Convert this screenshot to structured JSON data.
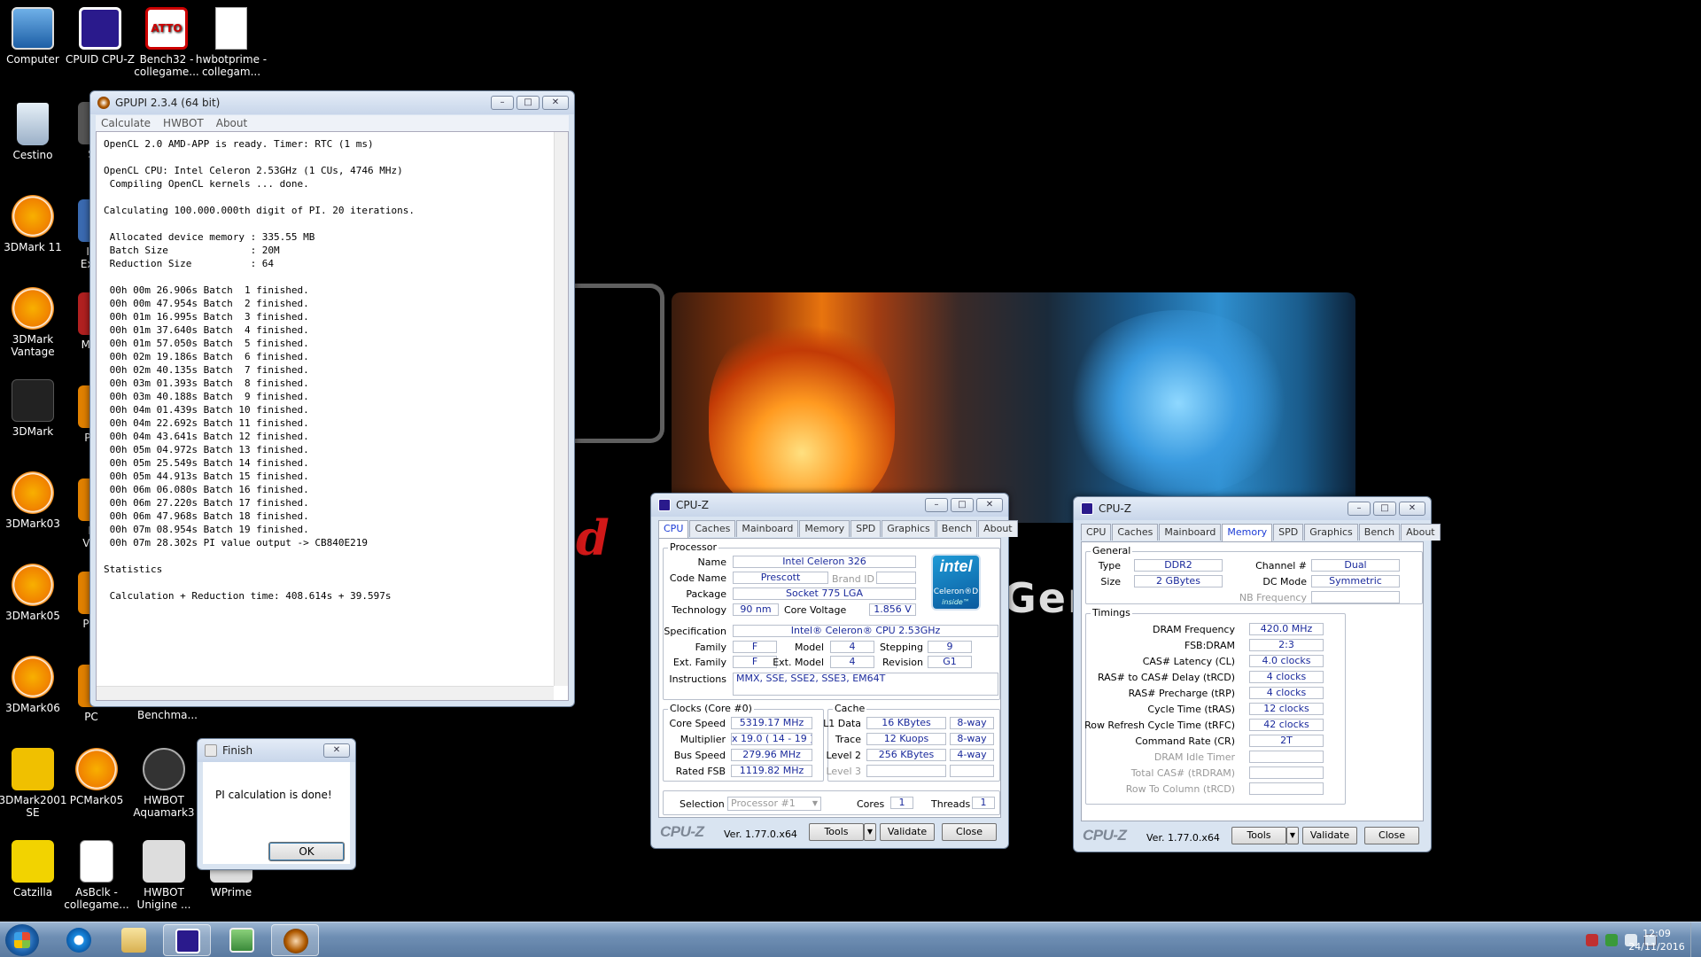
{
  "desktop": {
    "wallpaper_text_left": "d",
    "wallpaper_text_right": "Gene",
    "icons": [
      {
        "label": "Computer",
        "icon": "computer-icon"
      },
      {
        "label": "CPUID CPU-Z",
        "icon": "cpuz-icon"
      },
      {
        "label": "Bench32 - collegame...",
        "icon": "atto-icon",
        "badge": "ATTO"
      },
      {
        "label": "hwbotprime - collegam...",
        "icon": "document-icon"
      },
      {
        "label": "Cestino",
        "icon": "recycle-bin-icon"
      },
      {
        "label": "3DMark 11",
        "icon": "3dmark-icon"
      },
      {
        "label": "3DMark Vantage",
        "icon": "3dmark-icon"
      },
      {
        "label": "3DMark",
        "icon": "3dmark-arrow-icon"
      },
      {
        "label": "3DMark03",
        "icon": "3dmark-icon"
      },
      {
        "label": "3DMark05",
        "icon": "3dmark-icon"
      },
      {
        "label": "3DMark06",
        "icon": "3dmark-icon"
      },
      {
        "label": "3DMark2001 SE",
        "icon": "3dmark2001-icon"
      },
      {
        "label": "PCMark05",
        "icon": "pcmark-icon"
      },
      {
        "label": "HWBOT Aquamark3",
        "icon": "aquamark-icon"
      },
      {
        "label": "Catzilla",
        "icon": "catzilla-icon"
      },
      {
        "label": "AsBclk - collegame...",
        "icon": "asbclk-icon"
      },
      {
        "label": "HWBOT Unigine ...",
        "icon": "unigine-icon"
      },
      {
        "label": "WPrime",
        "icon": "wprime-icon"
      },
      {
        "label": "Benchma...",
        "icon": "benchmark-icon"
      }
    ],
    "partial_labels": [
      "S",
      "In Extr",
      "Mer",
      "PC",
      "P Var",
      "P V",
      "PC"
    ]
  },
  "gpupi": {
    "title": "GPUPI 2.3.4 (64 bit)",
    "menu": [
      "Calculate",
      "HWBOT",
      "About"
    ],
    "output_lines": [
      "OpenCL 2.0 AMD-APP is ready. Timer: RTC (1 ms)",
      "",
      "OpenCL CPU: Intel Celeron 2.53GHz (1 CUs, 4746 MHz)",
      " Compiling OpenCL kernels ... done.",
      "",
      "Calculating 100.000.000th digit of PI. 20 iterations.",
      "",
      " Allocated device memory : 335.55 MB",
      " Batch Size              : 20M",
      " Reduction Size          : 64",
      "",
      " 00h 00m 26.906s Batch  1 finished.",
      " 00h 00m 47.954s Batch  2 finished.",
      " 00h 01m 16.995s Batch  3 finished.",
      " 00h 01m 37.640s Batch  4 finished.",
      " 00h 01m 57.050s Batch  5 finished.",
      " 00h 02m 19.186s Batch  6 finished.",
      " 00h 02m 40.135s Batch  7 finished.",
      " 00h 03m 01.393s Batch  8 finished.",
      " 00h 03m 40.188s Batch  9 finished.",
      " 00h 04m 01.439s Batch 10 finished.",
      " 00h 04m 22.692s Batch 11 finished.",
      " 00h 04m 43.641s Batch 12 finished.",
      " 00h 05m 04.972s Batch 13 finished.",
      " 00h 05m 25.549s Batch 14 finished.",
      " 00h 05m 44.913s Batch 15 finished.",
      " 00h 06m 06.080s Batch 16 finished.",
      " 00h 06m 27.220s Batch 17 finished.",
      " 00h 06m 47.968s Batch 18 finished.",
      " 00h 07m 08.954s Batch 19 finished.",
      " 00h 07m 28.302s PI value output -> CB840E219",
      "",
      "Statistics",
      "",
      " Calculation + Reduction time: 408.614s + 39.597s"
    ]
  },
  "finish_dialog": {
    "title": "Finish",
    "message": "PI calculation is done!",
    "ok_label": "OK"
  },
  "cpuz_cpu": {
    "title": "CPU-Z",
    "tabs": [
      "CPU",
      "Caches",
      "Mainboard",
      "Memory",
      "SPD",
      "Graphics",
      "Bench",
      "About"
    ],
    "active_tab": "CPU",
    "processor_group": "Processor",
    "name_label": "Name",
    "name": "Intel Celeron 326",
    "codename_label": "Code Name",
    "codename": "Prescott",
    "brand_id_label": "Brand ID",
    "brand_id": "",
    "package_label": "Package",
    "package": "Socket 775 LGA",
    "technology_label": "Technology",
    "technology": "90 nm",
    "core_voltage_label": "Core Voltage",
    "core_voltage": "1.856 V",
    "specification_label": "Specification",
    "specification": "Intel® Celeron® CPU 2.53GHz",
    "family_label": "Family",
    "family": "F",
    "model_label": "Model",
    "model": "4",
    "stepping_label": "Stepping",
    "stepping": "9",
    "ext_family_label": "Ext. Family",
    "ext_family": "F",
    "ext_model_label": "Ext. Model",
    "ext_model": "4",
    "revision_label": "Revision",
    "revision": "G1",
    "instructions_label": "Instructions",
    "instructions": "MMX, SSE, SSE2, SSE3, EM64T",
    "logo": {
      "brand": "intel",
      "line2": "Celeron®D",
      "line3": "inside™"
    },
    "clocks_group": "Clocks (Core #0)",
    "core_speed_label": "Core Speed",
    "core_speed": "5319.17 MHz",
    "multiplier_label": "Multiplier",
    "multiplier": "x 19.0 ( 14 - 19 )",
    "bus_speed_label": "Bus Speed",
    "bus_speed": "279.96 MHz",
    "rated_fsb_label": "Rated FSB",
    "rated_fsb": "1119.82 MHz",
    "cache_group": "Cache",
    "l1_data_label": "L1 Data",
    "l1_data": "16 KBytes",
    "l1_data_way": "8-way",
    "trace_label": "Trace",
    "trace": "12 Kuops",
    "trace_way": "8-way",
    "level2_label": "Level 2",
    "level2": "256 KBytes",
    "level2_way": "4-way",
    "level3_label": "Level 3",
    "level3": "",
    "selection_label": "Selection",
    "selection": "Processor #1",
    "cores_label": "Cores",
    "cores": "1",
    "threads_label": "Threads",
    "threads": "1",
    "footer": {
      "logo": "CPU-Z",
      "version": "Ver. 1.77.0.x64",
      "tools": "Tools",
      "validate": "Validate",
      "close": "Close"
    }
  },
  "cpuz_mem": {
    "title": "CPU-Z",
    "tabs": [
      "CPU",
      "Caches",
      "Mainboard",
      "Memory",
      "SPD",
      "Graphics",
      "Bench",
      "About"
    ],
    "active_tab": "Memory",
    "general_group": "General",
    "type_label": "Type",
    "type": "DDR2",
    "size_label": "Size",
    "size": "2 GBytes",
    "channel_label": "Channel #",
    "channel": "Dual",
    "dc_mode_label": "DC Mode",
    "dc_mode": "Symmetric",
    "nb_freq_label": "NB Frequency",
    "nb_freq": "",
    "timings_group": "Timings",
    "timings": [
      {
        "label": "DRAM Frequency",
        "value": "420.0 MHz",
        "dim": false
      },
      {
        "label": "FSB:DRAM",
        "value": "2:3",
        "dim": false
      },
      {
        "label": "CAS# Latency (CL)",
        "value": "4.0 clocks",
        "dim": false
      },
      {
        "label": "RAS# to CAS# Delay (tRCD)",
        "value": "4 clocks",
        "dim": false
      },
      {
        "label": "RAS# Precharge (tRP)",
        "value": "4 clocks",
        "dim": false
      },
      {
        "label": "Cycle Time (tRAS)",
        "value": "12 clocks",
        "dim": false
      },
      {
        "label": "Row Refresh Cycle Time (tRFC)",
        "value": "42 clocks",
        "dim": false
      },
      {
        "label": "Command Rate (CR)",
        "value": "2T",
        "dim": false
      },
      {
        "label": "DRAM Idle Timer",
        "value": "",
        "dim": true
      },
      {
        "label": "Total CAS# (tRDRAM)",
        "value": "",
        "dim": true
      },
      {
        "label": "Row To Column (tRCD)",
        "value": "",
        "dim": true
      }
    ],
    "footer": {
      "logo": "CPU-Z",
      "version": "Ver. 1.77.0.x64",
      "tools": "Tools",
      "validate": "Validate",
      "close": "Close"
    }
  },
  "taskbar": {
    "time": "12:09",
    "date": "24/11/2016",
    "pinned": [
      "internet-explorer-icon",
      "explorer-folder-icon",
      "cpuz-icon",
      "image-viewer-icon",
      "gpupi-icon"
    ]
  }
}
